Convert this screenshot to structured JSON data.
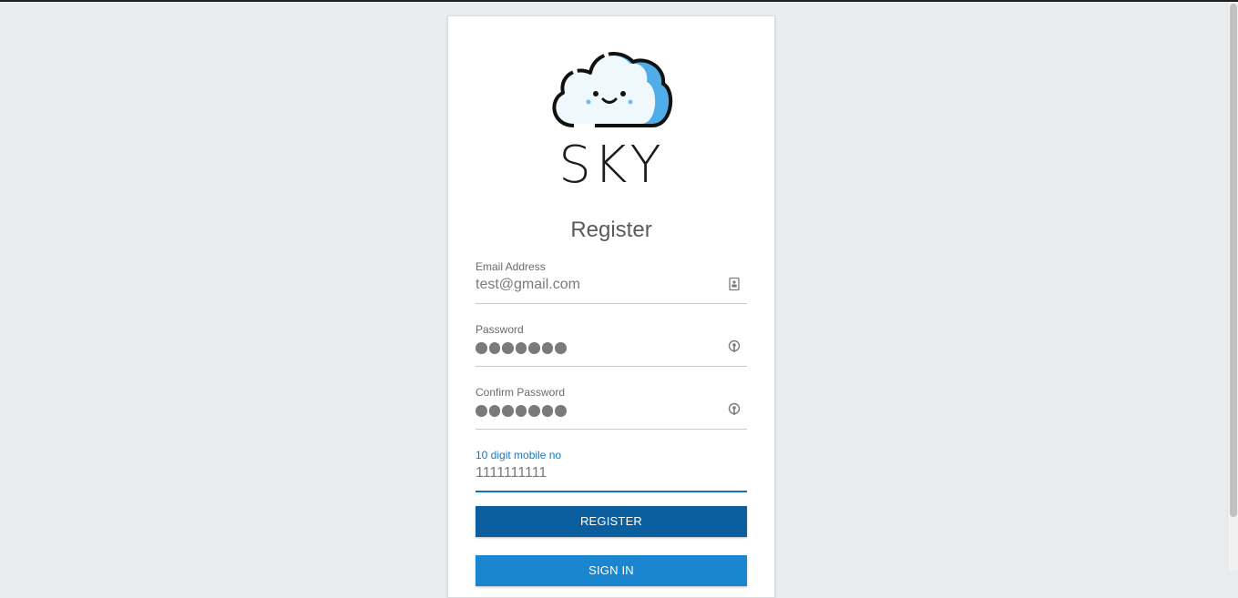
{
  "brand": {
    "name": "SKY"
  },
  "form": {
    "title": "Register",
    "fields": [
      {
        "label": "Email Address",
        "value": "test@gmail.com",
        "icon": "contact-card-icon"
      },
      {
        "label": "Password",
        "masked_length": 7,
        "icon": "key-icon"
      },
      {
        "label": "Confirm Password",
        "masked_length": 7,
        "icon": "key-icon"
      },
      {
        "label": "10 digit mobile no",
        "value": "1111111111",
        "focused": true
      }
    ],
    "register_label": "REGISTER",
    "signin_label": "SIGN IN"
  },
  "colors": {
    "background": "#e9edf0",
    "register_button": "#0b5f9e",
    "signin_button": "#1a86cf",
    "focus_accent": "#1479c4",
    "logo_blue": "#4faee8"
  }
}
